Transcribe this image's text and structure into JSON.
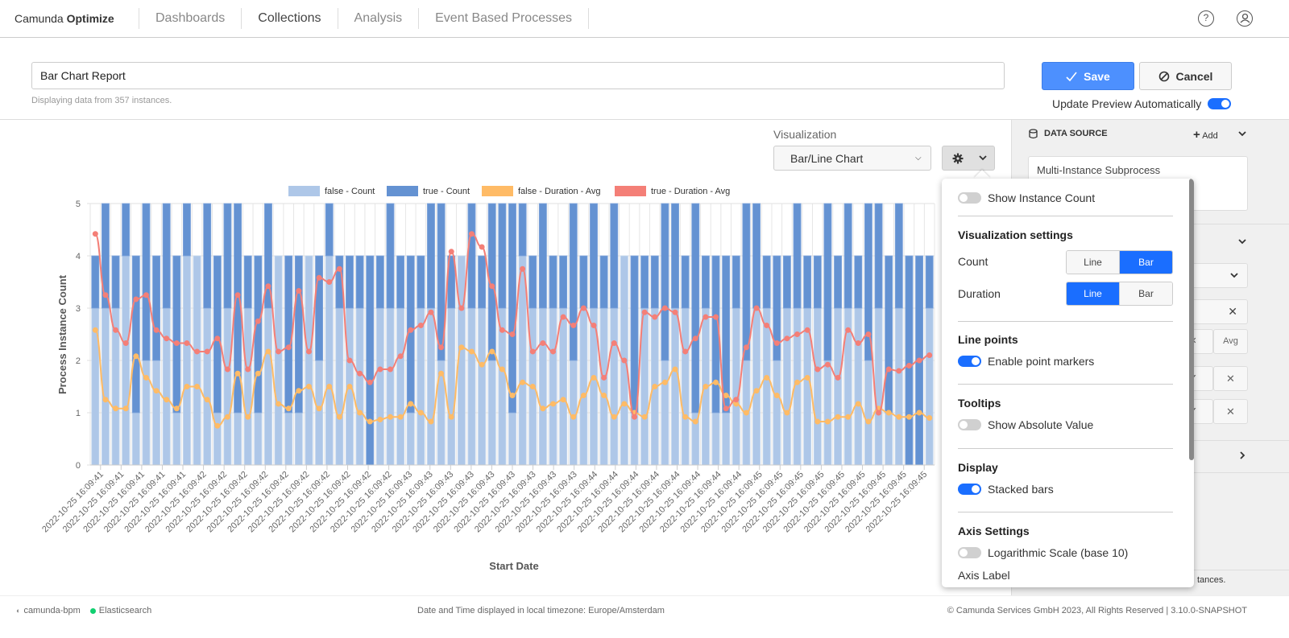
{
  "topbar": {
    "brand_light": "Camunda ",
    "brand_bold": "Optimize",
    "nav": [
      {
        "label": "Dashboards",
        "active": false
      },
      {
        "label": "Collections",
        "active": true
      },
      {
        "label": "Analysis",
        "active": false
      },
      {
        "label": "Event Based Processes",
        "active": false
      }
    ],
    "help_icon": "?",
    "user_icon": "user"
  },
  "header": {
    "report_name": "Bar Chart Report",
    "instances_text": "Displaying data from 357 instances.",
    "save_label": "Save",
    "cancel_label": "Cancel",
    "update_preview_label": "Update Preview Automatically",
    "update_preview_on": true
  },
  "visualization": {
    "label": "Visualization",
    "selected": "Bar/Line Chart"
  },
  "sidebar": {
    "data_source_title": "DATA SOURCE",
    "add_label": "Add",
    "process_name": "Multi-Instance Subprocess",
    "avg_label": "Avg",
    "bottom_text": "tances."
  },
  "popover": {
    "show_instance_count": {
      "label": "Show Instance Count",
      "on": false
    },
    "viz_settings_title": "Visualization settings",
    "count_label": "Count",
    "duration_label": "Duration",
    "line_label": "Line",
    "bar_label": "Bar",
    "count_selected": "Bar",
    "duration_selected": "Line",
    "line_points_title": "Line points",
    "point_markers": {
      "label": "Enable point markers",
      "on": true
    },
    "tooltips_title": "Tooltips",
    "absolute_value": {
      "label": "Show Absolute Value",
      "on": false
    },
    "display_title": "Display",
    "stacked_bars": {
      "label": "Stacked bars",
      "on": true
    },
    "axis_settings_title": "Axis Settings",
    "log_scale": {
      "label": "Logarithmic Scale (base 10)",
      "on": false
    },
    "axis_label": "Axis Label"
  },
  "footer": {
    "engine": "camunda-bpm",
    "db": "Elasticsearch",
    "timezone": "Date and Time displayed in local timezone: Europe/Amsterdam",
    "copyright": "© Camunda Services GmbH 2023, All Rights Reserved | 3.10.0-SNAPSHOT"
  },
  "chart_data": {
    "type": "bar",
    "title": "",
    "xlabel": "Start Date",
    "ylabel": "Process Instance Count",
    "ylim": [
      0,
      5
    ],
    "yticks": [
      0,
      1,
      2,
      3,
      4,
      5
    ],
    "grid": true,
    "stacked": true,
    "legend_position": "top-center",
    "colors": {
      "false_count": "#aec7e8",
      "true_count": "#6492d2",
      "false_duration": "#ffbb66",
      "true_duration": "#f47f77"
    },
    "x_labels": [
      "2022-10-25 16:09:41",
      "2022-10-25 16:09:41",
      "2022-10-25 16:09:41",
      "2022-10-25 16:09:41",
      "2022-10-25 16:09:41",
      "2022-10-25 16:09:42",
      "2022-10-25 16:09:42",
      "2022-10-25 16:09:42",
      "2022-10-25 16:09:42",
      "2022-10-25 16:09:42",
      "2022-10-25 16:09:42",
      "2022-10-25 16:09:42",
      "2022-10-25 16:09:42",
      "2022-10-25 16:09:42",
      "2022-10-25 16:09:42",
      "2022-10-25 16:09:43",
      "2022-10-25 16:09:43",
      "2022-10-25 16:09:43",
      "2022-10-25 16:09:43",
      "2022-10-25 16:09:43",
      "2022-10-25 16:09:43",
      "2022-10-25 16:09:43",
      "2022-10-25 16:09:43",
      "2022-10-25 16:09:43",
      "2022-10-25 16:09:44",
      "2022-10-25 16:09:44",
      "2022-10-25 16:09:44",
      "2022-10-25 16:09:44",
      "2022-10-25 16:09:44",
      "2022-10-25 16:09:44",
      "2022-10-25 16:09:44",
      "2022-10-25 16:09:44",
      "2022-10-25 16:09:45",
      "2022-10-25 16:09:45",
      "2022-10-25 16:09:45",
      "2022-10-25 16:09:45",
      "2022-10-25 16:09:45",
      "2022-10-25 16:09:45",
      "2022-10-25 16:09:45",
      "2022-10-25 16:09:45",
      "2022-10-25 16:09:45"
    ],
    "series": [
      {
        "name": "false - Count",
        "kind": "bar",
        "values": [
          3,
          3,
          3,
          4,
          1,
          2,
          2,
          3,
          1,
          4,
          4,
          3,
          1,
          3,
          1,
          3,
          1,
          3,
          4,
          1,
          1,
          4,
          2,
          4,
          3,
          3,
          3,
          0,
          3,
          3,
          3,
          1,
          3,
          3,
          2,
          3,
          4,
          3,
          3,
          2,
          3,
          1,
          4,
          3,
          3,
          3,
          3,
          2,
          3,
          3,
          3,
          3,
          4,
          1,
          3,
          3,
          2,
          3,
          3,
          1,
          3,
          1,
          1,
          3,
          2,
          3,
          3,
          2,
          3,
          3,
          3,
          3,
          2,
          3,
          3,
          3,
          2,
          3,
          1,
          3,
          0,
          0,
          3
        ]
      },
      {
        "name": "true - Count",
        "kind": "bar",
        "values": [
          1,
          2,
          1,
          1,
          3,
          3,
          2,
          2,
          3,
          1,
          0,
          2,
          3,
          2,
          4,
          1,
          3,
          2,
          0,
          3,
          3,
          0,
          2,
          1,
          1,
          1,
          1,
          4,
          1,
          2,
          1,
          3,
          1,
          2,
          3,
          1,
          0,
          2,
          1,
          3,
          2,
          4,
          1,
          1,
          2,
          1,
          1,
          3,
          1,
          2,
          1,
          2,
          0,
          3,
          1,
          1,
          3,
          2,
          1,
          4,
          1,
          3,
          3,
          1,
          3,
          2,
          1,
          2,
          1,
          2,
          1,
          1,
          3,
          1,
          2,
          1,
          3,
          2,
          3,
          2,
          4,
          4,
          1
        ]
      },
      {
        "name": "false - Duration - Avg",
        "kind": "line",
        "values": [
          2.58,
          1.25,
          1.08,
          1.08,
          2.08,
          1.67,
          1.42,
          1.25,
          1.08,
          1.5,
          1.5,
          1.25,
          0.75,
          0.92,
          1.75,
          0.92,
          1.75,
          2.17,
          1.17,
          1.08,
          1.42,
          1.5,
          1.08,
          1.5,
          0.92,
          1.5,
          1.0,
          0.83,
          0.87,
          0.92,
          0.92,
          1.17,
          1.0,
          0.83,
          1.75,
          0.92,
          2.25,
          2.17,
          1.92,
          2.17,
          1.83,
          1.33,
          1.58,
          1.5,
          1.08,
          1.17,
          1.25,
          0.92,
          1.33,
          1.67,
          1.33,
          0.92,
          1.17,
          1.0,
          0.92,
          1.5,
          1.58,
          1.83,
          0.92,
          0.83,
          1.5,
          1.58,
          1.33,
          1.17,
          1.0,
          1.42,
          1.67,
          1.33,
          1.0,
          1.58,
          1.67,
          0.83,
          0.83,
          0.92,
          0.92,
          1.17,
          0.83,
          1.08,
          1.0,
          0.92,
          0.92,
          1.0,
          0.9
        ]
      },
      {
        "name": "true - Duration - Avg",
        "kind": "line",
        "values": [
          4.42,
          3.25,
          2.58,
          2.33,
          3.17,
          3.25,
          2.58,
          2.42,
          2.33,
          2.33,
          2.17,
          2.17,
          2.42,
          1.83,
          3.25,
          1.83,
          2.75,
          3.42,
          2.17,
          2.25,
          3.33,
          2.17,
          3.58,
          3.5,
          3.75,
          2.0,
          1.75,
          1.58,
          1.83,
          1.83,
          2.08,
          2.58,
          2.67,
          2.92,
          2.25,
          4.08,
          3.0,
          4.42,
          4.17,
          3.42,
          2.58,
          2.5,
          3.75,
          2.17,
          2.33,
          2.17,
          2.83,
          2.67,
          3.0,
          2.67,
          1.67,
          2.33,
          2.0,
          0.92,
          2.92,
          2.83,
          3.0,
          2.92,
          2.17,
          2.42,
          2.83,
          2.83,
          1.08,
          1.25,
          2.25,
          3.0,
          2.67,
          2.33,
          2.42,
          2.5,
          2.58,
          1.83,
          1.92,
          1.67,
          2.58,
          2.33,
          2.5,
          1.0,
          1.83,
          1.8,
          1.9,
          2.0,
          2.1
        ]
      }
    ]
  }
}
